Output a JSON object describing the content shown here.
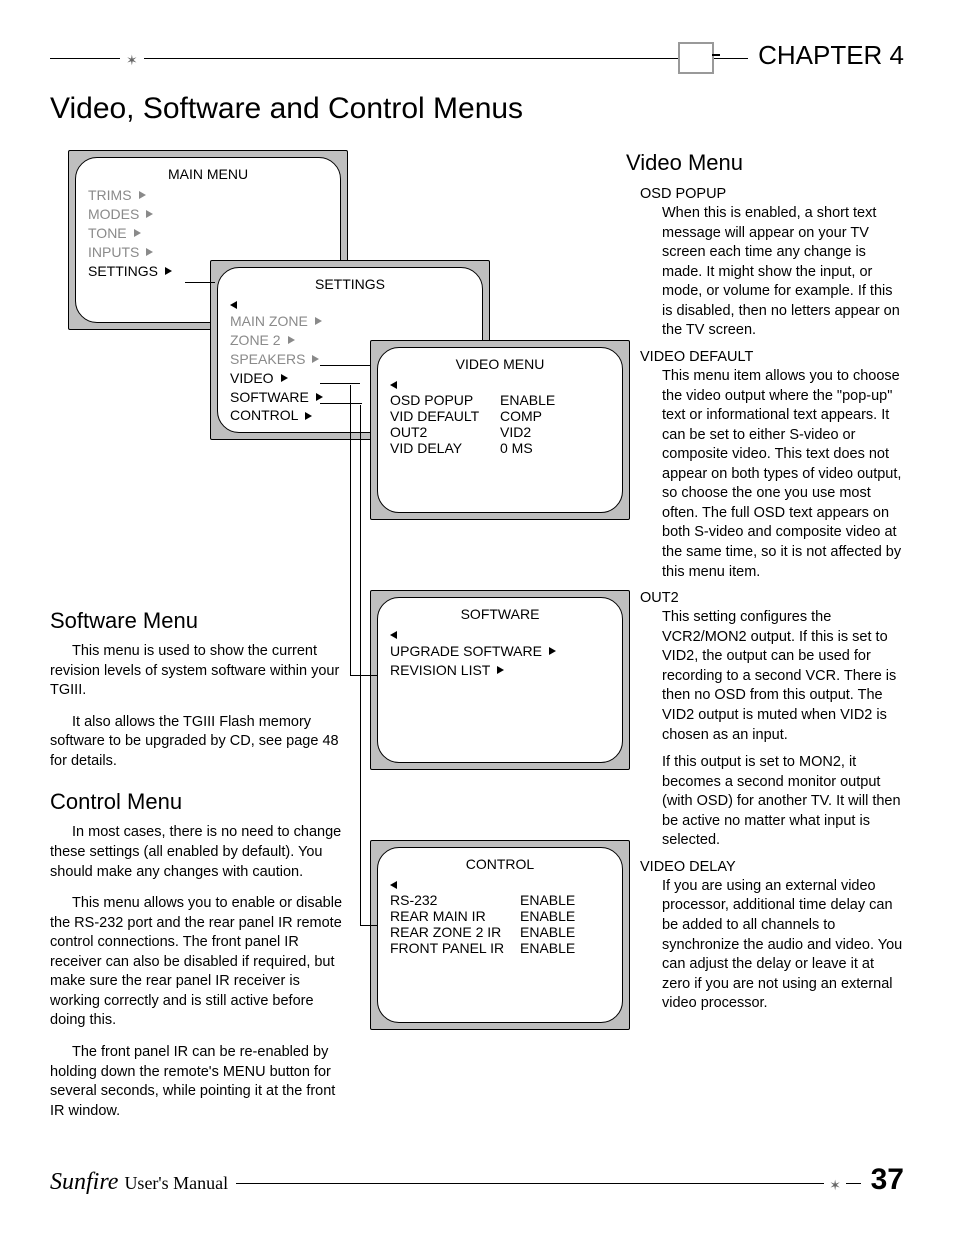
{
  "header": {
    "chapter": "CHAPTER 4"
  },
  "title": "Video, Software and Control Menus",
  "panels": {
    "main": {
      "title": "MAIN MENU",
      "items": [
        "TRIMS",
        "MODES",
        "TONE",
        "INPUTS",
        "SETTINGS"
      ]
    },
    "settings": {
      "title": "SETTINGS",
      "items": [
        "MAIN ZONE",
        "ZONE 2",
        "SPEAKERS",
        "VIDEO",
        "SOFTWARE",
        "CONTROL"
      ]
    },
    "video": {
      "title": "VIDEO MENU",
      "rows": [
        {
          "l": "OSD POPUP",
          "r": "ENABLE"
        },
        {
          "l": "VID DEFAULT",
          "r": "COMP"
        },
        {
          "l": "OUT2",
          "r": "VID2"
        },
        {
          "l": "VID DELAY",
          "r": "0 MS"
        }
      ]
    },
    "software": {
      "title": "SOFTWARE",
      "items": [
        "UPGRADE SOFTWARE",
        "REVISION LIST"
      ]
    },
    "control": {
      "title": "CONTROL",
      "rows": [
        {
          "l": "RS-232",
          "r": "ENABLE"
        },
        {
          "l": "REAR MAIN IR",
          "r": "ENABLE"
        },
        {
          "l": "REAR ZONE 2 IR",
          "r": "ENABLE"
        },
        {
          "l": "FRONT PANEL IR",
          "r": "ENABLE"
        }
      ]
    }
  },
  "sections": {
    "software": {
      "heading": "Software Menu",
      "p1": "This menu is used to show the current revision levels of system software within your TGIII.",
      "p2": "It also allows the TGIII Flash memory software to be upgraded by CD, see page 48 for details."
    },
    "control": {
      "heading": "Control Menu",
      "p1": "In most cases, there is no need to change these settings (all enabled by default). You should make any changes with caution.",
      "p2": "This menu allows you to enable or disable the RS-232 port and the rear panel IR remote control connections. The front panel IR receiver can also be disabled if required, but make sure the rear panel IR receiver is working correctly and is still active before doing this.",
      "p3": "The front panel IR can be re-enabled by holding down the remote's MENU button for several seconds, while pointing it at the front IR window."
    }
  },
  "right": {
    "heading": "Video Menu",
    "items": [
      {
        "title": "OSD POPUP",
        "body": "When this is enabled, a short text message will appear on your TV screen each time any change is made. It might show the input, or mode, or volume for example. If this is disabled, then no letters appear on the TV screen."
      },
      {
        "title": "VIDEO DEFAULT",
        "body": "This menu item allows you to choose the video output where the \"pop-up\" text or informational text appears. It can be set to either S-video or composite video. This text does not appear on both types of video output, so choose the one you use most often. The full OSD text appears on both S-video and composite video at the same time, so it is not affected by this menu item."
      },
      {
        "title": "OUT2",
        "body": "This setting configures the VCR2/MON2 output. If this is set to VID2, the output can be used for recording to a second VCR. There is then no OSD from this output. The VID2 output is muted when VID2 is chosen as an input."
      },
      {
        "title": "",
        "body": "If this output is set to MON2, it becomes  a second monitor output (with OSD) for another TV. It will then be active no matter what input is selected."
      },
      {
        "title": "VIDEO DELAY",
        "body": "If you are using an external video processor, additional time delay can be added to all channels to synchronize the audio and video. You can adjust the delay or leave it at zero if you are not using an external video processor."
      }
    ]
  },
  "footer": {
    "brand": "Sunfire",
    "manual": "User's Manual",
    "page": "37"
  }
}
